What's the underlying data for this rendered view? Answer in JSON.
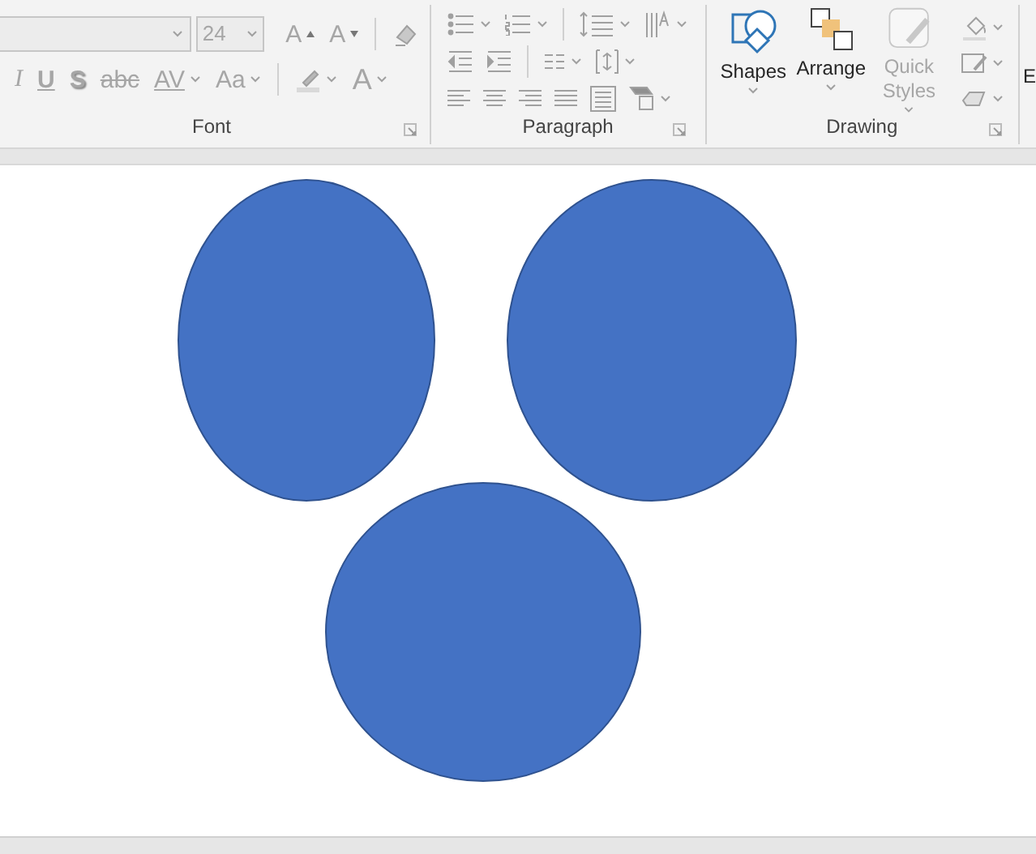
{
  "ribbon": {
    "groups": [
      {
        "kind": "font",
        "label": "Font",
        "disabled": true,
        "font_size": "24",
        "row_1": [
          {
            "kind": "grow",
            "label": "A"
          },
          {
            "kind": "shrink",
            "label": "A"
          },
          {
            "kind": "clear"
          }
        ],
        "row_2": [
          {
            "kind": "italic",
            "label": "I"
          },
          {
            "kind": "underline",
            "label": "U"
          },
          {
            "kind": "shadow",
            "label": "S"
          },
          {
            "kind": "strike",
            "label": "abc"
          },
          {
            "kind": "spacing",
            "label": "AV",
            "dropdown": true
          },
          {
            "kind": "case",
            "label": "Aa",
            "dropdown": true
          },
          {
            "kind": "highlight",
            "dropdown": true
          },
          {
            "kind": "color",
            "label": "A",
            "dropdown": true
          }
        ]
      },
      {
        "kind": "paragraph",
        "label": "Paragraph",
        "disabled": true,
        "rows": [
          [
            {
              "kind": "bullets",
              "dropdown": true
            },
            {
              "kind": "numbering",
              "dropdown": true
            },
            {
              "kind": "line_spacing",
              "dropdown": true
            },
            {
              "kind": "text_direction",
              "dropdown": true
            }
          ],
          [
            {
              "kind": "decrease_indent"
            },
            {
              "kind": "increase_indent"
            },
            {
              "kind": "columns",
              "dropdown": true
            },
            {
              "kind": "align_text",
              "dropdown": true
            }
          ],
          [
            {
              "kind": "align_left"
            },
            {
              "kind": "align_center"
            },
            {
              "kind": "align_right"
            },
            {
              "kind": "justify"
            },
            {
              "kind": "distribute"
            },
            {
              "kind": "smartart",
              "dropdown": true
            }
          ]
        ]
      },
      {
        "kind": "drawing",
        "label": "Drawing",
        "large": [
          {
            "kind": "shapes",
            "label": "Shapes",
            "disabled": false
          },
          {
            "kind": "arrange",
            "label": "Arrange",
            "disabled": false
          },
          {
            "kind": "quick_styles",
            "label": "Quick Styles",
            "disabled": true
          }
        ],
        "small": [
          {
            "kind": "fill",
            "dropdown": true
          },
          {
            "kind": "outline",
            "dropdown": true
          },
          {
            "kind": "effects",
            "dropdown": true
          }
        ]
      }
    ],
    "cut_off": "E"
  },
  "slide": {
    "shapes": [
      {
        "kind": "ellipse"
      },
      {
        "kind": "ellipse"
      },
      {
        "kind": "ellipse"
      }
    ]
  }
}
